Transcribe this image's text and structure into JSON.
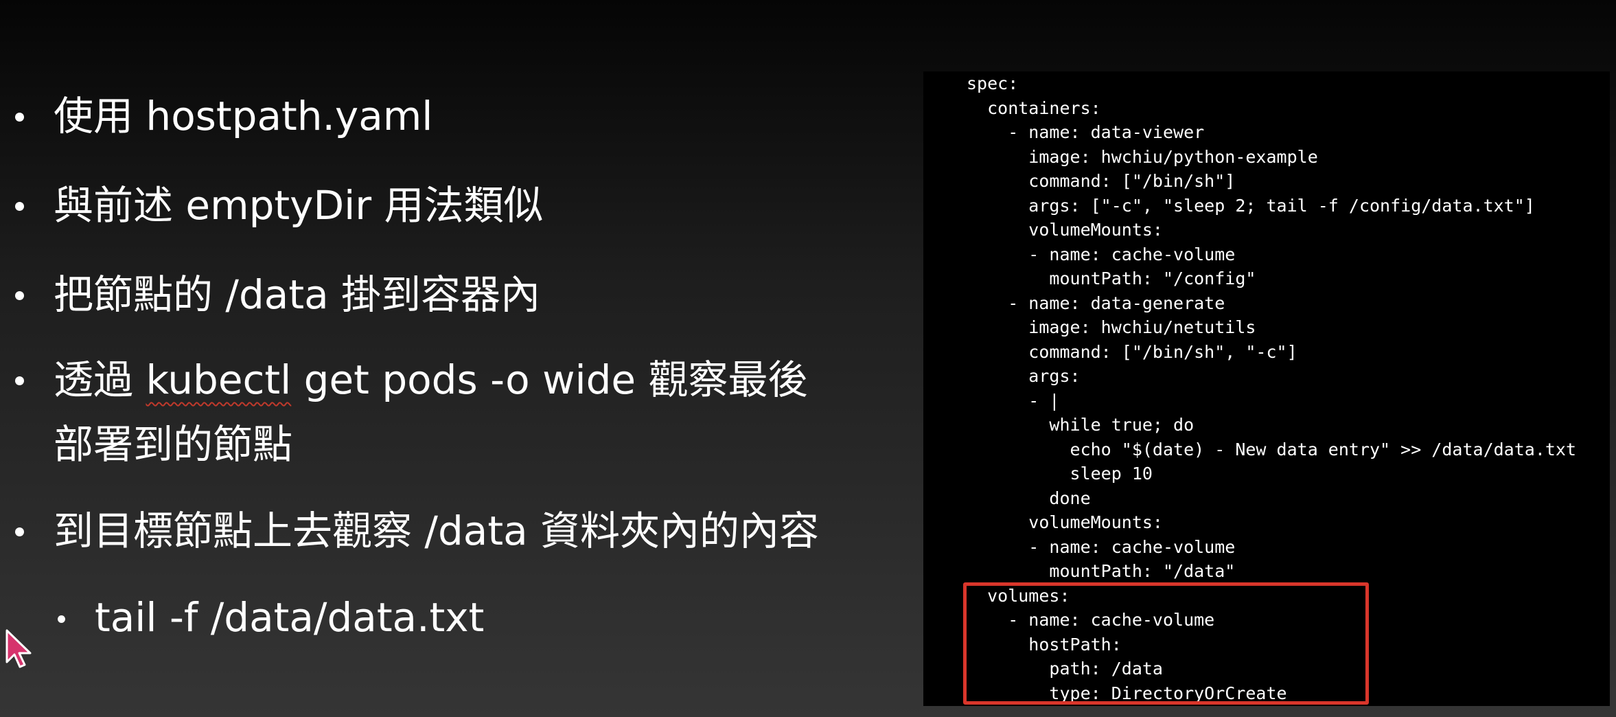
{
  "slide": {
    "bullets": [
      {
        "text": "使用 hostpath.yaml"
      },
      {
        "text": "與前述 emptyDir 用法類似"
      },
      {
        "text": "把節點的 /data 掛到容器內"
      },
      {
        "text_pre": "透過 ",
        "text_underlined": "kubectl",
        "text_post": " get pods -o wide 觀察最後",
        "text_line2": "部署到的節點"
      },
      {
        "text": "到目標節點上去觀察 /data 資料夾內的內容"
      }
    ],
    "sub_bullets": [
      {
        "text": "tail -f /data/data.txt"
      }
    ]
  },
  "code_panel": {
    "lines": [
      "spec:",
      "  containers:",
      "    - name: data-viewer",
      "      image: hwchiu/python-example",
      "      command: [\"/bin/sh\"]",
      "      args: [\"-c\", \"sleep 2; tail -f /config/data.txt\"]",
      "      volumeMounts:",
      "      - name: cache-volume",
      "        mountPath: \"/config\"",
      "    - name: data-generate",
      "      image: hwchiu/netutils",
      "      command: [\"/bin/sh\", \"-c\"]",
      "      args:",
      "      - |",
      "        while true; do",
      "          echo \"$(date) - New data entry\" >> /data/data.txt",
      "          sleep 10",
      "        done",
      "      volumeMounts:",
      "      - name: cache-volume",
      "        mountPath: \"/data\"",
      "  volumes:",
      "    - name: cache-volume",
      "      hostPath:",
      "        path: /data",
      "        type: DirectoryOrCreate"
    ]
  },
  "colors": {
    "highlight_border": "#d9362b",
    "cursor_fill": "#d6336c"
  },
  "icons": {
    "cursor": "mouse-pointer-icon"
  }
}
